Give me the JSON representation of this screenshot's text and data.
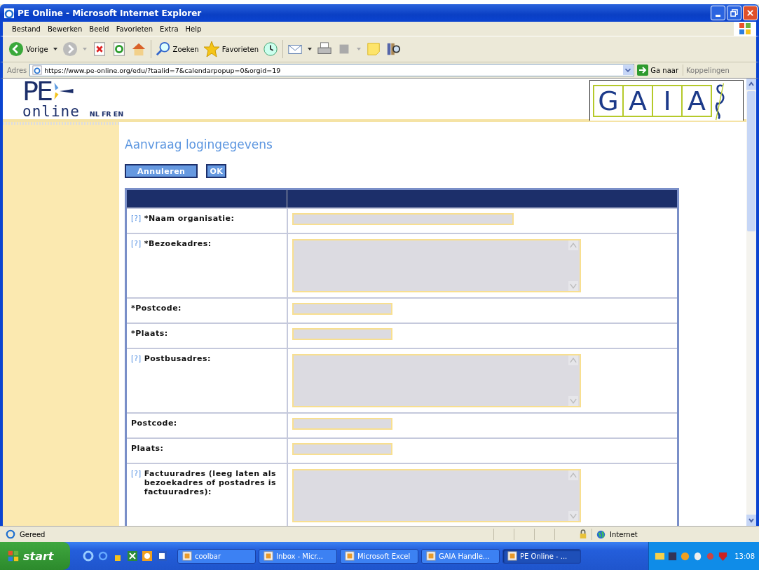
{
  "window": {
    "title": "PE Online - Microsoft Internet Explorer"
  },
  "menu": [
    "Bestand",
    "Bewerken",
    "Beeld",
    "Favorieten",
    "Extra",
    "Help"
  ],
  "toolbar": {
    "back": "Vorige",
    "search": "Zoeken",
    "favorites": "Favorieten"
  },
  "address": {
    "label": "Adres",
    "url": "https://www.pe-online.org/edu/?taalid=7&calendarpopup=0&orgid=19",
    "go": "Ga naar",
    "links": "Koppelingen"
  },
  "site": {
    "logo_top": "PE",
    "logo_bottom": "online",
    "languages": [
      "NL",
      "FR",
      "EN"
    ],
    "partner_logo": [
      "G",
      "A",
      "I",
      "A"
    ]
  },
  "page": {
    "title": "Aanvraag logingegevens",
    "buttons": [
      "Annuleren",
      "OK"
    ]
  },
  "form": [
    {
      "help": "[?]",
      "label": "*Naam organisatie:",
      "kind": "wide-text"
    },
    {
      "help": "[?]",
      "label": "*Bezoekadres:",
      "kind": "textarea"
    },
    {
      "label": "*Postcode:",
      "kind": "short-text"
    },
    {
      "label": "*Plaats:",
      "kind": "short-text"
    },
    {
      "help": "[?]",
      "label": "Postbusadres:",
      "kind": "textarea"
    },
    {
      "label": "Postcode:",
      "kind": "short-text"
    },
    {
      "label": "Plaats:",
      "kind": "short-text"
    },
    {
      "help": "[?]",
      "label": "Factuuradres (leeg laten als bezoekadres of postadres is factuuradres):",
      "kind": "textarea"
    }
  ],
  "status_bar": {
    "text": "Gereed",
    "zone": "Internet"
  },
  "taskbar": {
    "start": "start",
    "tasks": [
      {
        "label": "coolbar",
        "selected": false
      },
      {
        "label": "Inbox - Micr...",
        "selected": false
      },
      {
        "label": "Microsoft Excel",
        "selected": false
      },
      {
        "label": "GAIA Handle...",
        "selected": false
      },
      {
        "label": "PE Online - ...",
        "selected": true
      }
    ],
    "clock": "13:08"
  }
}
